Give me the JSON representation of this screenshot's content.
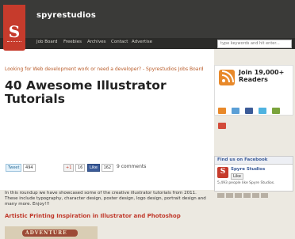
{
  "site": {
    "name": "spyrestudios",
    "logo_letter": "S"
  },
  "nav": {
    "items": [
      "Job Board",
      "Freebies",
      "Archives",
      "Contact",
      "Advertise"
    ]
  },
  "search": {
    "placeholder": "type keywords and hit enter..."
  },
  "promo": {
    "text": "Looking for Web development work or need a developer? - Spyrestudios Jobs Board"
  },
  "article": {
    "title": "40 Awesome Illustrator Tutorials",
    "intro": "In this roundup we have showcased some of the creative illustrator tutorials from 2011. These include typography, character design, poster design, logo design, portrait design and many more. Enjoy!!!",
    "section_heading": "Artistic Printing Inspiration in Illustrator and Photoshop",
    "image_banner_text": "ADVENTURE"
  },
  "share": {
    "tweet_label": "Tweet",
    "tweet_count": "494",
    "gplus_label": "+1",
    "gplus_count": "16",
    "fb_label": "Like",
    "fb_count": "162",
    "comments": "9 comments"
  },
  "sidebar": {
    "join_line1": "Join 19,000+",
    "join_line2": "Readers",
    "facebook_header": "Find us on Facebook",
    "facebook_page_name": "Spyre Studios",
    "facebook_like": "Like",
    "facebook_count_text": "5,493 people like Spyre Studios."
  },
  "colors": {
    "brand": "#c63b2c",
    "topbar": "#3a3a38",
    "heading": "#c0392b",
    "rss": "#e8892a",
    "facebook": "#3b5b98"
  }
}
